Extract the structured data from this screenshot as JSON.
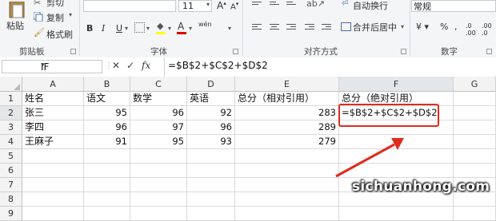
{
  "ribbon": {
    "clipboard": {
      "paste": "粘贴",
      "cut": "剪切",
      "copy": "复制",
      "format_painter": "格式刷",
      "group": "剪贴板"
    },
    "font": {
      "size": "11",
      "bold": "B",
      "italic": "I",
      "underline": "U",
      "phonetic": "wén",
      "group": "字体"
    },
    "alignment": {
      "wrap_text": "自动换行",
      "merge_center": "合并后居中",
      "group": "对齐方式"
    },
    "number": {
      "format": "常规",
      "group": "数字"
    }
  },
  "formula_bar": {
    "name_box": "IF",
    "fx": "fx",
    "formula": "=$B$2+$C$2+$D$2"
  },
  "sheet": {
    "columns": [
      "A",
      "B",
      "C",
      "D",
      "E",
      "F",
      "G"
    ],
    "rows": [
      "1",
      "2",
      "3",
      "4",
      "5",
      "6",
      "7",
      "8",
      "9"
    ],
    "header_row": [
      "姓名",
      "语文",
      "数学",
      "英语",
      "总分（相对引用）",
      "总分（绝对引用）"
    ],
    "data": [
      {
        "name": "张三",
        "chinese": "95",
        "math": "96",
        "english": "92",
        "total_relative": "283",
        "total_absolute": "=$B$2+$C$2+$D$2"
      },
      {
        "name": "李四",
        "chinese": "96",
        "math": "97",
        "english": "96",
        "total_relative": "289",
        "total_absolute": ""
      },
      {
        "name": "王麻子",
        "chinese": "91",
        "math": "95",
        "english": "93",
        "total_relative": "279",
        "total_absolute": ""
      }
    ]
  },
  "annotation": {
    "arrow_color": "#e12b1e",
    "box_color": "#e12b1e"
  },
  "watermark": "sichuanhong.com"
}
